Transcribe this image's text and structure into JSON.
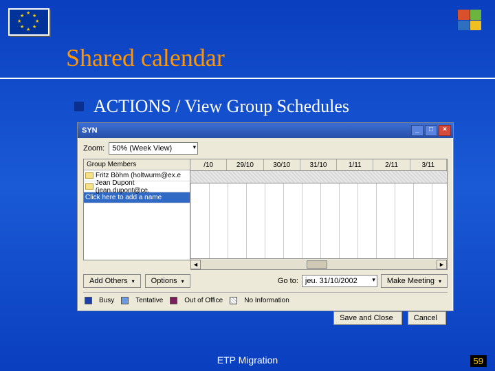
{
  "slide": {
    "title": "Shared calendar",
    "bullet": "ACTIONS / View Group Schedules",
    "footer": "ETP Migration",
    "page": "59"
  },
  "dialog": {
    "title": "SYN",
    "zoom_label": "Zoom:",
    "zoom_value": "50% (Week View)",
    "members_header": "Group Members",
    "members": [
      "Fritz Böhm (holtwurm@ex.e",
      "Jean Dupont (jean.dupont@ce.",
      "Click here to add a name"
    ],
    "dates": [
      "/10",
      "29/10",
      "30/10",
      "31/10",
      "1/11",
      "2/11",
      "3/11"
    ],
    "add_others": "Add Others",
    "options": "Options",
    "goto_label": "Go to:",
    "goto_value": "jeu. 31/10/2002",
    "make_meeting": "Make Meeting",
    "legend": {
      "busy": "Busy",
      "tentative": "Tentative",
      "oof": "Out of Office",
      "noinfo": "No Information"
    },
    "save_close": "Save and Close",
    "cancel": "Cancel"
  }
}
